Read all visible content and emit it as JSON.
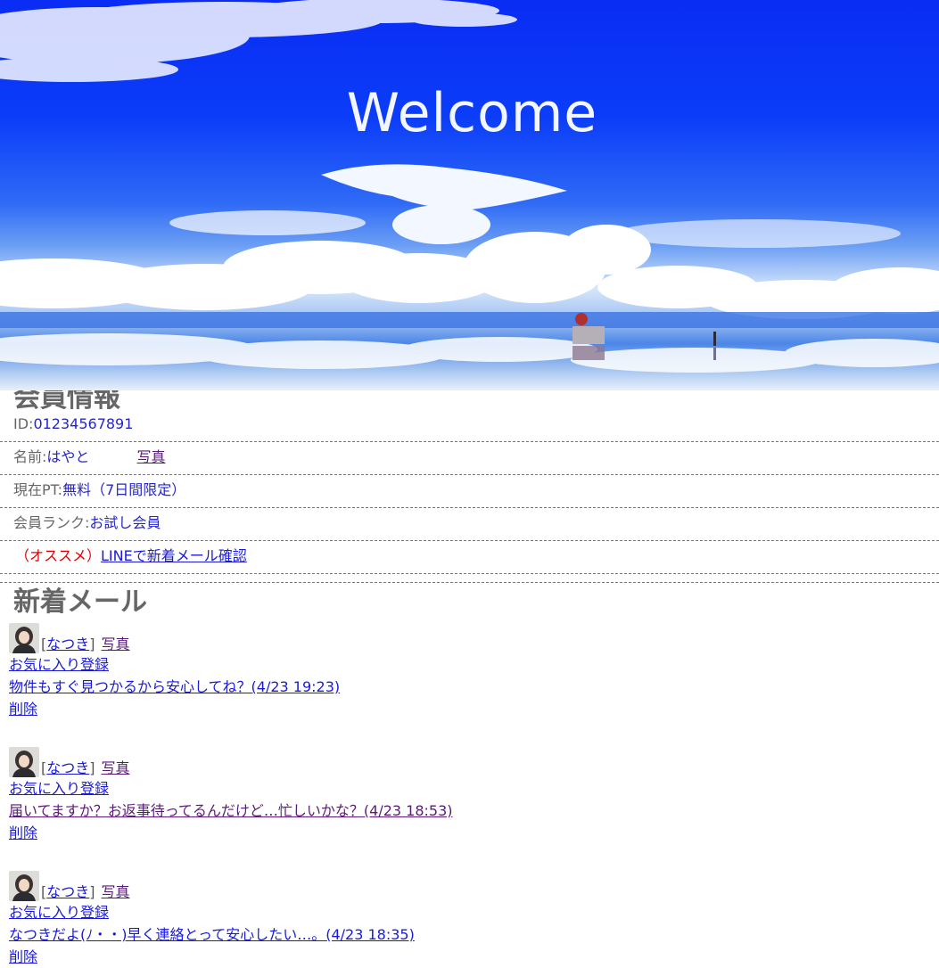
{
  "hero": {
    "title": "Welcome"
  },
  "member": {
    "heading": "会員情報",
    "id_label": "ID:",
    "id_value": "01234567891",
    "name_label": "名前:",
    "name_value": "はやと",
    "photo_link": "写真",
    "points_label": "現在PT:",
    "points_value": "無料（7日間限定）",
    "rank_label": "会員ランク:",
    "rank_value": "お試し会員",
    "recommend_label": "（オススメ）",
    "line_link": "LINEで新着メール確認"
  },
  "mail": {
    "heading": "新着メール",
    "items": [
      {
        "bracket_open": "[",
        "sender": "なつき",
        "bracket_close": "]",
        "photo": "写真",
        "favorite": "お気に入り登録",
        "message": "物件もすぐ見つかるから安心してね？(4/23 19:23)",
        "delete": "削除"
      },
      {
        "bracket_open": "[",
        "sender": "なつき",
        "bracket_close": "]",
        "photo": "写真",
        "favorite": "お気に入り登録",
        "message": "届いてますか？お返事待ってるんだけど…忙しいかな？(4/23 18:53)",
        "delete": "削除"
      },
      {
        "bracket_open": "[",
        "sender": "なつき",
        "bracket_close": "]",
        "photo": "写真",
        "favorite": "お気に入り登録",
        "message": "なつきだよ(ﾉ・・)早く連絡とって安心したい…。(4/23 18:35)",
        "delete": "削除"
      }
    ]
  },
  "colors": {
    "link": "#1a1ad6",
    "visited_link": "#5a1a78",
    "heading": "#666666",
    "value": "#2626c8",
    "recommend": "#e00000",
    "sky": "#0a2cf4"
  }
}
